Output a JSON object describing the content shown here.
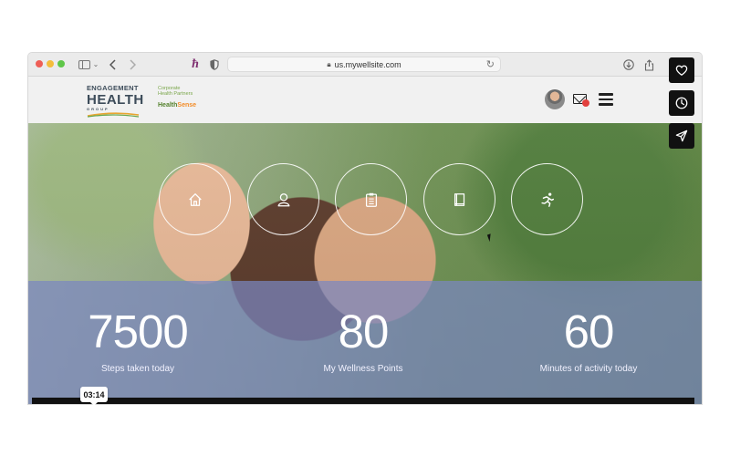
{
  "browser": {
    "url": "us.mywellsite.com",
    "icons": [
      "sidebar-icon",
      "back-icon",
      "forward-icon",
      "extension-icon",
      "shield-icon",
      "lock-icon",
      "reload-icon",
      "download-icon",
      "share-icon"
    ]
  },
  "header": {
    "logo_primary": {
      "line1": "ENGAGEMENT",
      "line2": "HEALTH",
      "line3": "GROUP"
    },
    "logo_secondary": {
      "line1": "Corporate",
      "line2": "Health Partners",
      "brand": "Health",
      "brand_suffix": "Sense"
    },
    "icons": [
      "avatar",
      "mail-icon",
      "menu-icon"
    ]
  },
  "hero_nav": [
    {
      "name": "home",
      "icon": "home-icon"
    },
    {
      "name": "profile",
      "icon": "user-icon"
    },
    {
      "name": "clipboard",
      "icon": "clipboard-icon"
    },
    {
      "name": "book",
      "icon": "book-icon"
    },
    {
      "name": "activity",
      "icon": "running-icon"
    }
  ],
  "stats": [
    {
      "value": "7500",
      "label": "Steps taken today"
    },
    {
      "value": "80",
      "label": "My Wellness Points"
    },
    {
      "value": "60",
      "label": "Minutes of activity today"
    }
  ],
  "overlay": {
    "timestamp": "03:14",
    "side_buttons": [
      "heart-icon",
      "clock-icon",
      "send-icon"
    ]
  },
  "colors": {
    "stats_band": "#7a86c0",
    "mail_badge": "#e2403d",
    "traffic_red": "#ee5e56",
    "traffic_yellow": "#f4bd3b",
    "traffic_green": "#5fc649"
  }
}
